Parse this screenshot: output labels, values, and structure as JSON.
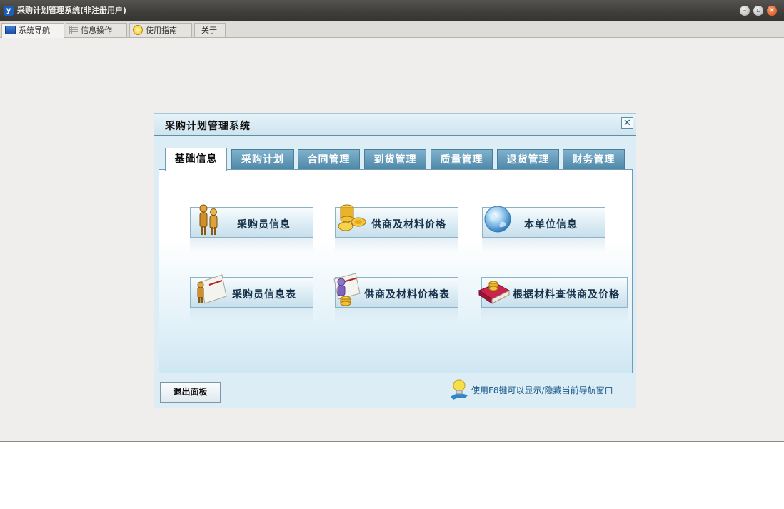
{
  "window": {
    "title": "采购计划管理系统(非注册用户)",
    "app_icon": "y"
  },
  "top_tabs": [
    {
      "label": "系统导航",
      "icon": "monitor-icon"
    },
    {
      "label": "信息操作",
      "icon": "grid-icon"
    },
    {
      "label": "使用指南",
      "icon": "bulb-icon"
    },
    {
      "label": "关于",
      "icon": ""
    }
  ],
  "panel": {
    "title": "采购计划管理系统",
    "close_symbol": "✕",
    "tabs": [
      {
        "label": "基础信息"
      },
      {
        "label": "采购计划"
      },
      {
        "label": "合同管理"
      },
      {
        "label": "到货管理"
      },
      {
        "label": "质量管理"
      },
      {
        "label": "退货管理"
      },
      {
        "label": "财务管理"
      }
    ],
    "buttons": [
      {
        "label": "采购员信息",
        "icon": "people-icon"
      },
      {
        "label": "供商及材料价格",
        "icon": "coins-icon"
      },
      {
        "label": "本单位信息",
        "icon": "globe-icon"
      },
      {
        "label": "采购员信息表",
        "icon": "scroll-people-icon"
      },
      {
        "label": "供商及材料价格表",
        "icon": "scroll-coins-icon"
      },
      {
        "label": "根据材料查供商及价格",
        "icon": "book-coins-icon"
      }
    ],
    "exit_label": "退出面板",
    "hint": "使用F8键可以显示/隐藏当前导航窗口"
  },
  "colors": {
    "title_bar": "#3f3e3a",
    "panel_tab": "#5b93b3",
    "panel_bg": "#dcedf6",
    "hint_text": "#1b5c8c"
  }
}
